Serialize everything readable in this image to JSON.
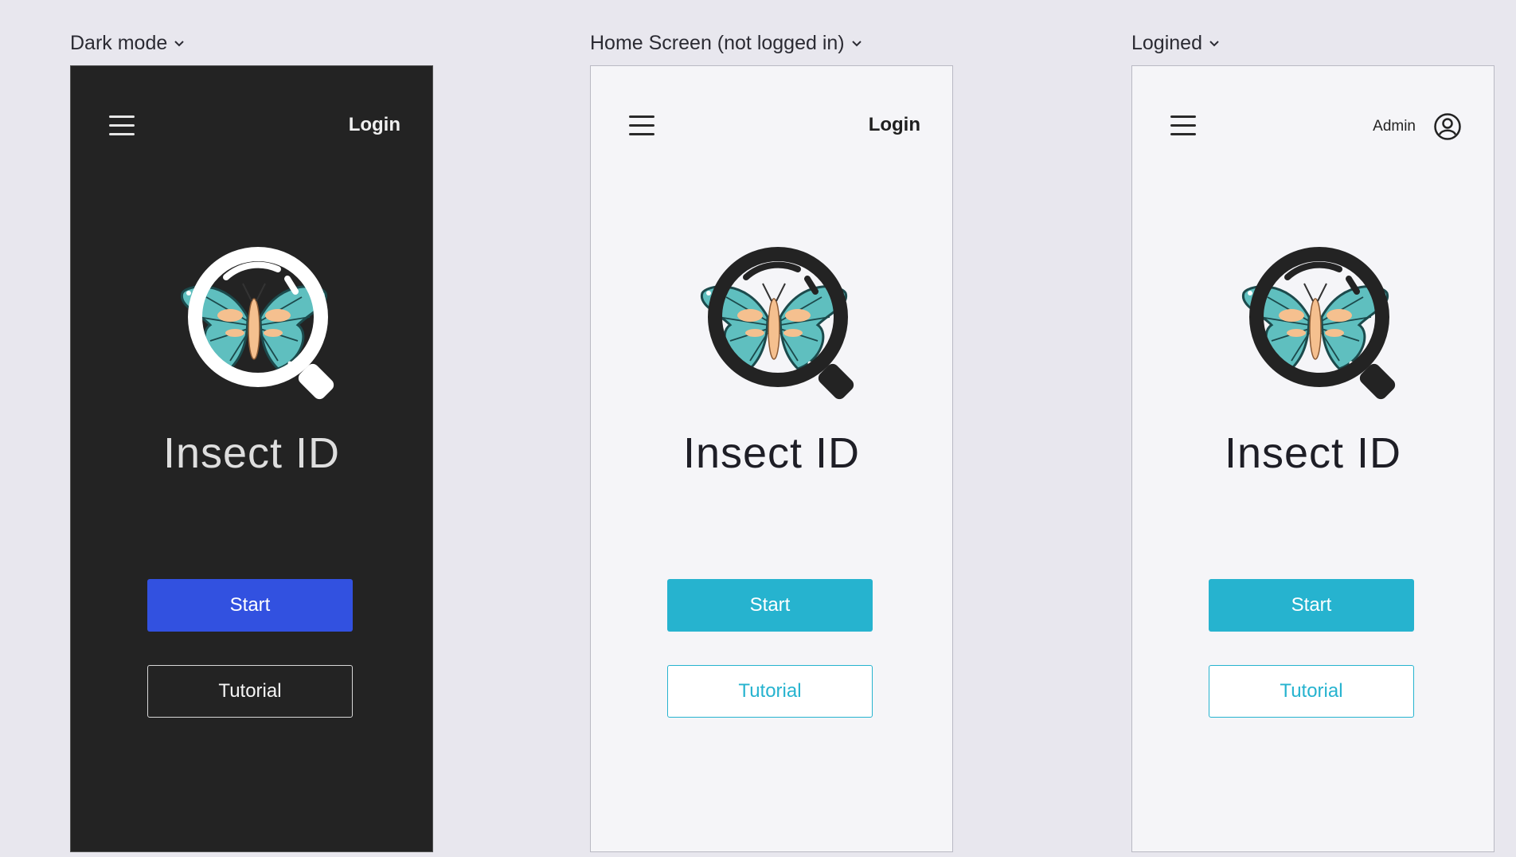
{
  "frames": [
    {
      "label": "Dark mode",
      "login": "Login",
      "title": "Insect ID",
      "start": "Start",
      "tutorial": "Tutorial"
    },
    {
      "label": "Home Screen (not logged in)",
      "login": "Login",
      "title": "Insect ID",
      "start": "Start",
      "tutorial": "Tutorial"
    },
    {
      "label": "Logined",
      "user": "Admin",
      "title": "Insect ID",
      "start": "Start",
      "tutorial": "Tutorial"
    }
  ],
  "colors": {
    "canvas": "#e8e7ee",
    "dark_bg": "#232323",
    "dark_accent": "#3251e0",
    "light_bg": "#f5f5f8",
    "light_accent": "#26b3cf",
    "wing_teal": "#5fbfbf",
    "body_peach": "#f5c08f"
  },
  "icons": [
    "menu-icon",
    "chevron-down-icon",
    "user-avatar-icon",
    "butterfly-magnifier-logo"
  ]
}
